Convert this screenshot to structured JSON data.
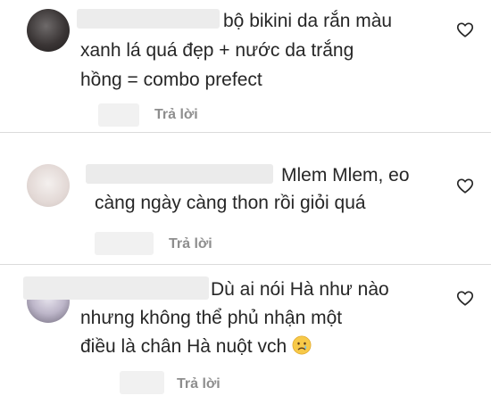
{
  "comments": [
    {
      "text_lines": [
        "bộ bikini da rắn màu",
        "xanh lá quá đẹp + nước da trắng",
        "hồng = combo prefect"
      ],
      "reply_label": "Trả lời",
      "like_icon": "heart-outline-icon"
    },
    {
      "text_lines": [
        "Mlem Mlem, eo",
        "càng ngày càng thon rồi giỏi quá"
      ],
      "reply_label": "Trả lời",
      "like_icon": "heart-outline-icon"
    },
    {
      "text_lines": [
        "Dù ai nói Hà như nào",
        "nhưng không thể phủ nhận một",
        "điều là chân Hà nuột vch"
      ],
      "trailing_emoji": "crying-face-emoji",
      "reply_label": "Trả lời",
      "like_icon": "heart-outline-icon"
    }
  ],
  "colors": {
    "text": "#262626",
    "secondary_text": "#8e8e8e",
    "divider": "#dbdbdb",
    "redaction": "#eeeeee"
  }
}
